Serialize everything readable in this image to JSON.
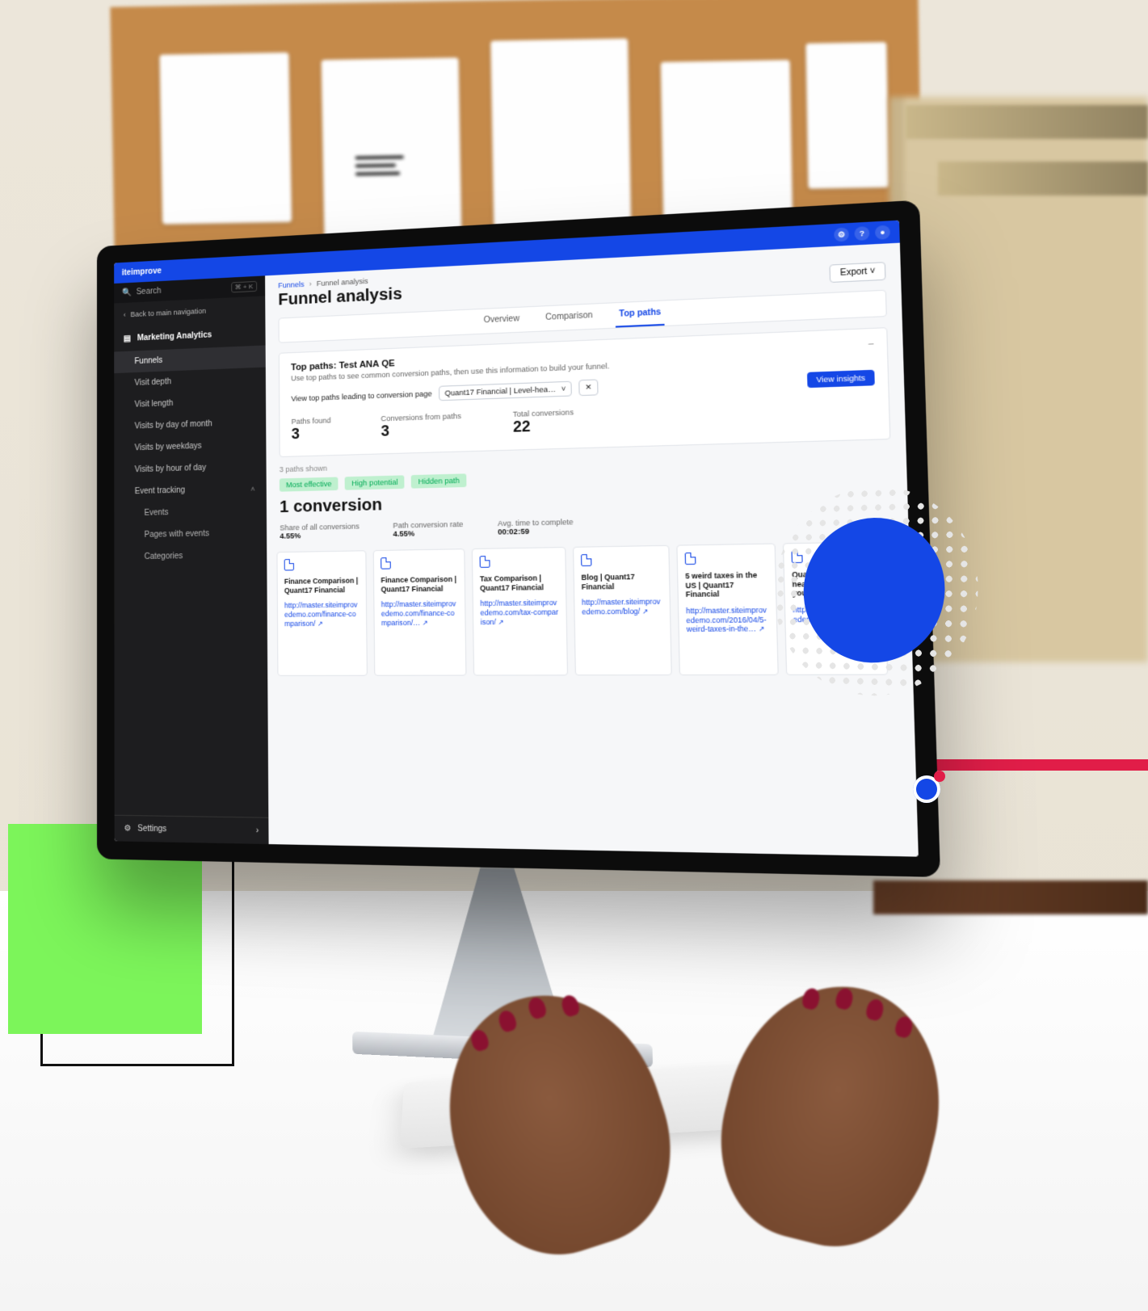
{
  "brand": "iteimprove",
  "search": {
    "label": "Search",
    "shortcut": "⌘ + K"
  },
  "sidebar": {
    "back": "Back to main navigation",
    "section": "Marketing Analytics",
    "items": [
      {
        "label": "Funnels",
        "active": true
      },
      {
        "label": "Visit depth"
      },
      {
        "label": "Visit length"
      },
      {
        "label": "Visits by day of month"
      },
      {
        "label": "Visits by weekdays"
      },
      {
        "label": "Visits by hour of day"
      },
      {
        "label": "Event tracking",
        "expandable": true
      },
      {
        "label": "Events",
        "sub": true
      },
      {
        "label": "Pages with events",
        "sub": true
      },
      {
        "label": "Categories",
        "sub": true
      }
    ],
    "settings": "Settings"
  },
  "breadcrumbs": {
    "a": "Funnels",
    "b": "Funnel analysis"
  },
  "page": {
    "title": "Funnel analysis",
    "export": "Export"
  },
  "tabs": {
    "overview": "Overview",
    "comparison": "Comparison",
    "toppaths": "Top paths"
  },
  "panel": {
    "title": "Top paths: Test ANA QE",
    "subtitle": "Use top paths to see common conversion paths, then use this information to build your funnel.",
    "filter_label": "View top paths leading to conversion page",
    "filter_value": "Quant17 Financial | Level-hea…",
    "view_btn": "View insights",
    "stats": [
      {
        "label": "Paths found",
        "value": "3"
      },
      {
        "label": "Conversions from paths",
        "value": "3"
      },
      {
        "label": "Total conversions",
        "value": "22"
      }
    ]
  },
  "shown": "3 paths shown",
  "chips": [
    "Most effective",
    "High potential",
    "Hidden path"
  ],
  "conversion_title": "1 conversion",
  "metrics": [
    {
      "label": "Share of all conversions",
      "value": "4.55%"
    },
    {
      "label": "Path conversion rate",
      "value": "4.55%"
    },
    {
      "label": "Avg. time to complete",
      "value": "00:02:59"
    }
  ],
  "steps": [
    {
      "name": "Finance Comparison | Quant17 Financial",
      "url": "http://master.siteimprovedemo.com/finance-comparison/"
    },
    {
      "name": "Finance Comparison | Quant17 Financial",
      "url": "http://master.siteimprovedemo.com/finance-comparison/…"
    },
    {
      "name": "Tax Comparison | Quant17 Financial",
      "url": "http://master.siteimprovedemo.com/tax-comparison/"
    },
    {
      "name": "Blog | Quant17 Financial",
      "url": "http://master.siteimprovedemo.com/blog/"
    },
    {
      "name": "5 weird taxes in the US | Quant17 Financial",
      "url": "http://master.siteimprovedemo.com/2016/04/5-weird-taxes-in-the…"
    },
    {
      "name": "Quant17 Fin… Level-headed solutions for your…",
      "url": "http://master.siteimprovedemo.com…"
    }
  ],
  "icons": {
    "gear": "⚙",
    "help": "?",
    "user": "●",
    "chev": "›",
    "chev_down": "˅",
    "back": "‹",
    "close": "✕",
    "ext": "↗",
    "bars": "▤",
    "collapse": "–"
  }
}
